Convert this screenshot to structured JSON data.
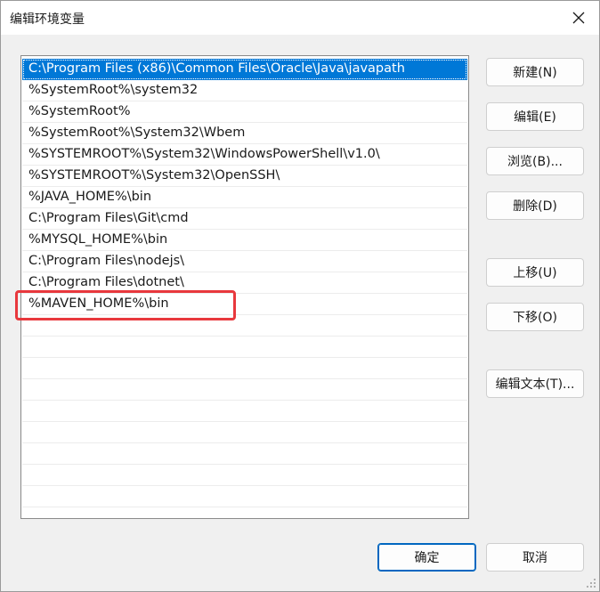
{
  "window": {
    "title": "编辑环境变量",
    "close_icon": "close-icon"
  },
  "list": {
    "items": [
      "C:\\Program Files (x86)\\Common Files\\Oracle\\Java\\javapath",
      "%SystemRoot%\\system32",
      "%SystemRoot%",
      "%SystemRoot%\\System32\\Wbem",
      "%SYSTEMROOT%\\System32\\WindowsPowerShell\\v1.0\\",
      "%SYSTEMROOT%\\System32\\OpenSSH\\",
      "%JAVA_HOME%\\bin",
      "C:\\Program Files\\Git\\cmd",
      "%MYSQL_HOME%\\bin",
      "C:\\Program Files\\nodejs\\",
      "C:\\Program Files\\dotnet\\",
      "%MAVEN_HOME%\\bin"
    ],
    "selected_index": 0,
    "highlighted_index": 11
  },
  "buttons": {
    "new": "新建(N)",
    "edit": "编辑(E)",
    "browse": "浏览(B)...",
    "delete": "删除(D)",
    "move_up": "上移(U)",
    "move_down": "下移(O)",
    "edit_text": "编辑文本(T)...",
    "ok": "确定",
    "cancel": "取消"
  },
  "colors": {
    "selection": "#0078d7",
    "highlight_border": "#e8383d",
    "primary_border": "#0067c0"
  }
}
